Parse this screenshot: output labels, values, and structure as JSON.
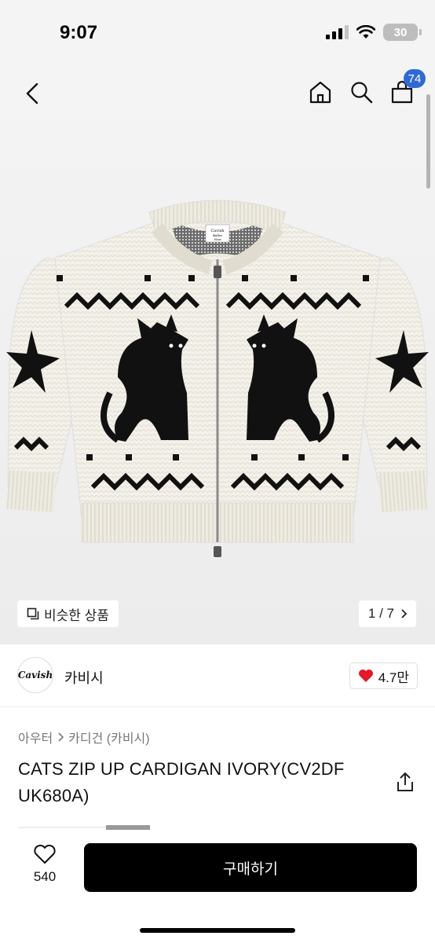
{
  "status_bar": {
    "time": "9:07",
    "battery": "30",
    "icons": [
      "signal-icon",
      "wifi-icon",
      "battery-icon"
    ]
  },
  "nav": {
    "icons": [
      "back-icon",
      "home-icon",
      "search-icon",
      "cart-icon"
    ],
    "cart_badge": "74"
  },
  "gallery": {
    "similar_label": "비슷한 상품",
    "page_indicator": "1 / 7",
    "image_label_lines": [
      "Cavish",
      "Ballet",
      "Noir"
    ]
  },
  "brand": {
    "logo_text": "Cavish",
    "name": "카비시",
    "likes": "4.7만"
  },
  "product": {
    "breadcrumb": [
      "아우터",
      "카디건 (카비시)"
    ],
    "title": "CATS ZIP UP CARDIGAN IVORY(CV2DF UK680A)"
  },
  "bottom_bar": {
    "wish_count": "540",
    "buy_label": "구매하기"
  },
  "colors": {
    "badge": "#2f6ad4",
    "like_heart": "#e5182a",
    "buy_button": "#000000"
  }
}
